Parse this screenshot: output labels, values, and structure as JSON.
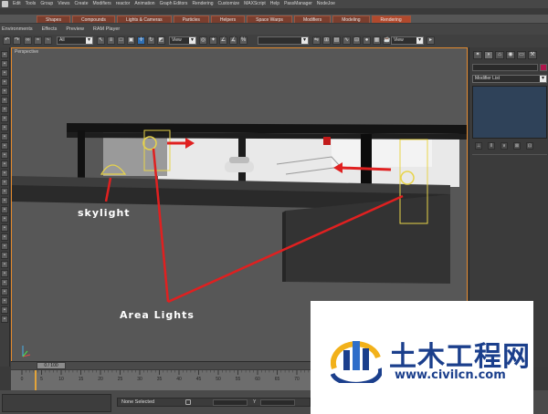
{
  "menubar": {
    "items": [
      "Edit",
      "Tools",
      "Group",
      "Views",
      "Create",
      "Modifiers",
      "reactor",
      "Animation",
      "Graph Editors",
      "Rendering",
      "Customize",
      "MAXScript",
      "Help",
      "PassManager",
      "NodeJoe"
    ]
  },
  "command_tabs": {
    "items": [
      {
        "label": "Shapes",
        "active": false
      },
      {
        "label": "Compounds",
        "active": false
      },
      {
        "label": "Lights & Cameras",
        "active": false
      },
      {
        "label": "Particles",
        "active": false
      },
      {
        "label": "Helpers",
        "active": false
      },
      {
        "label": "Space Warps",
        "active": false
      },
      {
        "label": "Modifiers",
        "active": false
      },
      {
        "label": "Modeling",
        "active": false
      },
      {
        "label": "Rendering",
        "active": true
      }
    ]
  },
  "secondary_toolbar": {
    "items": [
      "Environments",
      "Effects",
      "Preview",
      "RAM Player"
    ]
  },
  "main_toolbar": {
    "selection_filter": "All",
    "ref_coord_1": "View",
    "ref_coord_2": "View"
  },
  "viewport": {
    "label": "Perspective",
    "annotations": {
      "skylight": "skylight",
      "area_lights": "Area Lights"
    },
    "annotation_color": "#e02020",
    "light_color": "#e8d44a",
    "border_color": "#e38a2e"
  },
  "command_panel": {
    "modifier_list_label": "Modifier List",
    "stack_color": "#2f4259",
    "object_color": "#b0154a"
  },
  "time": {
    "slider_label": "0 / 100",
    "track_ticks": [
      "0",
      "5",
      "10",
      "15",
      "20",
      "25",
      "30",
      "35",
      "40",
      "45",
      "50",
      "55",
      "60",
      "65",
      "70",
      "75"
    ]
  },
  "status": {
    "selection": "None Selected",
    "y_label": "Y"
  },
  "watermark": {
    "title": "土木工程网",
    "url": "www.civilcn.com",
    "color": "#1b3f8c"
  },
  "icons": [
    "max-logo-icon",
    "select-icon",
    "move-icon",
    "rotate-icon",
    "scale-icon",
    "snap-icon",
    "mirror-icon",
    "align-icon",
    "render-icon",
    "lock-icon",
    "pin-icon",
    "axis-gizmo-icon",
    "watermark-logo-icon"
  ]
}
